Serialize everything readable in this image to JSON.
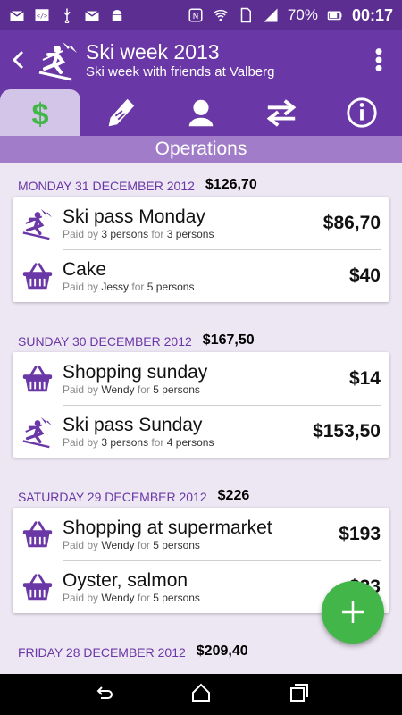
{
  "status_bar": {
    "left_icons": [
      "mail-check-icon",
      "code-icon",
      "usb-icon",
      "mail-check-icon",
      "android-icon"
    ],
    "battery": "70%",
    "time": "00:17"
  },
  "header": {
    "title": "Ski week 2013",
    "subtitle": "Ski week with friends at Valberg"
  },
  "tabs": [
    {
      "icon": "dollar-icon",
      "active": true
    },
    {
      "icon": "tag-icon",
      "active": false
    },
    {
      "icon": "person-icon",
      "active": false
    },
    {
      "icon": "transfer-icon",
      "active": false
    },
    {
      "icon": "info-icon",
      "active": false
    }
  ],
  "section_title": "Operations",
  "labels": {
    "paid_by": "Paid by",
    "for": "for"
  },
  "days": [
    {
      "date": "MONDAY 31 DECEMBER 2012",
      "total": "$126,70",
      "operations": [
        {
          "icon": "skier-icon",
          "name": "Ski pass Monday",
          "paid_by": "3 persons",
          "for": "3 persons",
          "amount": "$86,70"
        },
        {
          "icon": "basket-icon",
          "name": "Cake",
          "paid_by": "Jessy",
          "for": "5 persons",
          "amount": "$40"
        }
      ]
    },
    {
      "date": "SUNDAY 30 DECEMBER 2012",
      "total": "$167,50",
      "operations": [
        {
          "icon": "basket-icon",
          "name": "Shopping sunday",
          "paid_by": "Wendy",
          "for": "5 persons",
          "amount": "$14"
        },
        {
          "icon": "skier-icon",
          "name": "Ski pass Sunday",
          "paid_by": "3 persons",
          "for": "4 persons",
          "amount": "$153,50"
        }
      ]
    },
    {
      "date": "SATURDAY 29 DECEMBER 2012",
      "total": "$226",
      "operations": [
        {
          "icon": "basket-icon",
          "name": "Shopping at supermarket",
          "paid_by": "Wendy",
          "for": "5 persons",
          "amount": "$193"
        },
        {
          "icon": "basket-icon",
          "name": "Oyster, salmon",
          "paid_by": "Wendy",
          "for": "5 persons",
          "amount": "$33"
        }
      ]
    },
    {
      "date": "FRIDAY 28 DECEMBER 2012",
      "total": "$209,40",
      "operations": []
    }
  ],
  "colors": {
    "primary": "#6a37a6",
    "accent": "#43b649",
    "status": "#5c2e91"
  }
}
